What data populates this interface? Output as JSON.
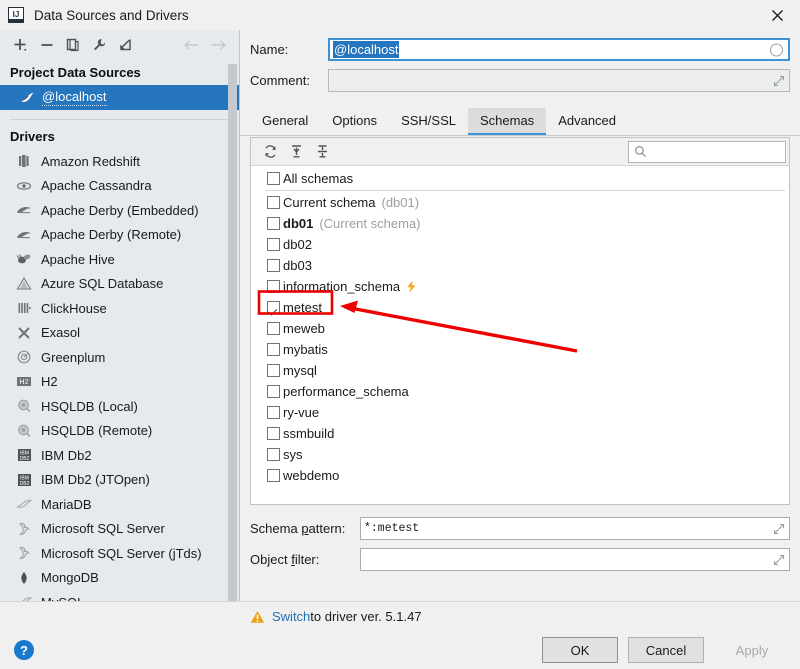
{
  "window": {
    "title": "Data Sources and Drivers",
    "app_icon": "intellij-icon",
    "close_icon": "close-icon"
  },
  "left_toolbar": {
    "buttons": [
      {
        "name": "add-button",
        "icon": "plus-icon",
        "label": "+"
      },
      {
        "name": "remove-button",
        "icon": "minus-icon",
        "label": "−"
      },
      {
        "name": "duplicate-button",
        "icon": "copy-icon",
        "label": "copy"
      },
      {
        "name": "properties-button",
        "icon": "wrench-icon",
        "label": "wrench"
      },
      {
        "name": "jump-to-button",
        "icon": "arrow-into-corner-icon",
        "label": "jump"
      }
    ],
    "nav_back": "arrow-left-icon",
    "nav_forward": "arrow-right-icon"
  },
  "project_data_sources": {
    "heading": "Project Data Sources",
    "items": [
      {
        "label": "@localhost",
        "icon": "mysql-dolphin-icon",
        "selected": true,
        "modified": true
      }
    ]
  },
  "drivers": {
    "heading": "Drivers",
    "items": [
      {
        "label": "Amazon Redshift",
        "icon": "redshift-icon"
      },
      {
        "label": "Apache Cassandra",
        "icon": "cassandra-eye-icon"
      },
      {
        "label": "Apache Derby (Embedded)",
        "icon": "derby-icon"
      },
      {
        "label": "Apache Derby (Remote)",
        "icon": "derby-icon"
      },
      {
        "label": "Apache Hive",
        "icon": "hive-bee-icon"
      },
      {
        "label": "Azure SQL Database",
        "icon": "azure-triangle-icon"
      },
      {
        "label": "ClickHouse",
        "icon": "clickhouse-bars-icon"
      },
      {
        "label": "Exasol",
        "icon": "exasol-x-icon"
      },
      {
        "label": "Greenplum",
        "icon": "greenplum-circle-icon"
      },
      {
        "label": "H2",
        "icon": "h2-icon"
      },
      {
        "label": "HSQLDB (Local)",
        "icon": "hsqldb-icon"
      },
      {
        "label": "HSQLDB (Remote)",
        "icon": "hsqldb-icon"
      },
      {
        "label": "IBM Db2",
        "icon": "ibm-db2-icon"
      },
      {
        "label": "IBM Db2 (JTOpen)",
        "icon": "ibm-db2-icon"
      },
      {
        "label": "MariaDB",
        "icon": "mariadb-seal-icon"
      },
      {
        "label": "Microsoft SQL Server",
        "icon": "mssql-icon"
      },
      {
        "label": "Microsoft SQL Server (jTds)",
        "icon": "mssql-icon"
      },
      {
        "label": "MongoDB",
        "icon": "mongodb-leaf-icon"
      },
      {
        "label": "MySQL",
        "icon": "mysql-dolphin-icon"
      }
    ]
  },
  "details": {
    "name_label": "Name:",
    "name_value": "@localhost",
    "name_indicator_icon": "circle-indicator-icon",
    "comment_label": "Comment:",
    "comment_value": "",
    "comment_placeholder": "",
    "comment_expand_icon": "expand-icon"
  },
  "tabs": [
    {
      "label": "General",
      "active": false
    },
    {
      "label": "Options",
      "active": false
    },
    {
      "label": "SSH/SSL",
      "active": false
    },
    {
      "label": "Schemas",
      "active": true
    },
    {
      "label": "Advanced",
      "active": false
    }
  ],
  "schemas_panel": {
    "toolbar": [
      {
        "name": "refresh-button",
        "icon": "refresh-icon"
      },
      {
        "name": "expand-all-button",
        "icon": "expand-all-icon"
      },
      {
        "name": "collapse-all-button",
        "icon": "collapse-all-icon"
      }
    ],
    "search": {
      "icon": "search-icon",
      "value": "",
      "placeholder": ""
    },
    "rows": [
      {
        "label": "All schemas",
        "checked": false,
        "bold": false,
        "sub": "",
        "bolt": false,
        "separator_after": true
      },
      {
        "label": "Current schema",
        "checked": false,
        "bold": false,
        "sub": "(db01)",
        "bolt": false
      },
      {
        "label": "db01",
        "checked": false,
        "bold": true,
        "sub": "(Current schema)",
        "bolt": false
      },
      {
        "label": "db02",
        "checked": false,
        "bold": false,
        "sub": "",
        "bolt": false
      },
      {
        "label": "db03",
        "checked": false,
        "bold": false,
        "sub": "",
        "bolt": false
      },
      {
        "label": "information_schema",
        "checked": false,
        "bold": false,
        "sub": "",
        "bolt": true
      },
      {
        "label": "metest",
        "checked": true,
        "bold": false,
        "sub": "",
        "bolt": false,
        "highlighted": true
      },
      {
        "label": "meweb",
        "checked": false,
        "bold": false,
        "sub": "",
        "bolt": false
      },
      {
        "label": "mybatis",
        "checked": false,
        "bold": false,
        "sub": "",
        "bolt": false
      },
      {
        "label": "mysql",
        "checked": false,
        "bold": false,
        "sub": "",
        "bolt": false
      },
      {
        "label": "performance_schema",
        "checked": false,
        "bold": false,
        "sub": "",
        "bolt": false
      },
      {
        "label": "ry-vue",
        "checked": false,
        "bold": false,
        "sub": "",
        "bolt": false
      },
      {
        "label": "ssmbuild",
        "checked": false,
        "bold": false,
        "sub": "",
        "bolt": false
      },
      {
        "label": "sys",
        "checked": false,
        "bold": false,
        "sub": "",
        "bolt": false
      },
      {
        "label": "webdemo",
        "checked": false,
        "bold": false,
        "sub": "",
        "bolt": false
      }
    ]
  },
  "patterns": {
    "schema_pattern_label_pre": "Schema ",
    "schema_pattern_label_mn": "p",
    "schema_pattern_label_post": "attern:",
    "schema_pattern_value": "*:metest",
    "object_filter_label_pre": "Object ",
    "object_filter_label_mn": "f",
    "object_filter_label_post": "ilter:",
    "object_filter_value": ""
  },
  "warning": {
    "icon": "warning-triangle-icon",
    "link_text": "Switch",
    "rest_text": " to driver ver. 5.1.47"
  },
  "footer": {
    "help_icon": "help-question-icon",
    "ok_label": "OK",
    "cancel_label": "Cancel",
    "apply_label": "Apply",
    "apply_disabled": true
  },
  "annotation": {
    "box_color": "#ee0000",
    "arrow_color": "#ee0000",
    "target": "metest"
  },
  "colors": {
    "accent": "#2675bf",
    "tab_accent": "#3c92d6",
    "link": "#2470b3",
    "warning": "#e8a317",
    "bolt": "#f5a623",
    "annotation": "#ee0000"
  }
}
